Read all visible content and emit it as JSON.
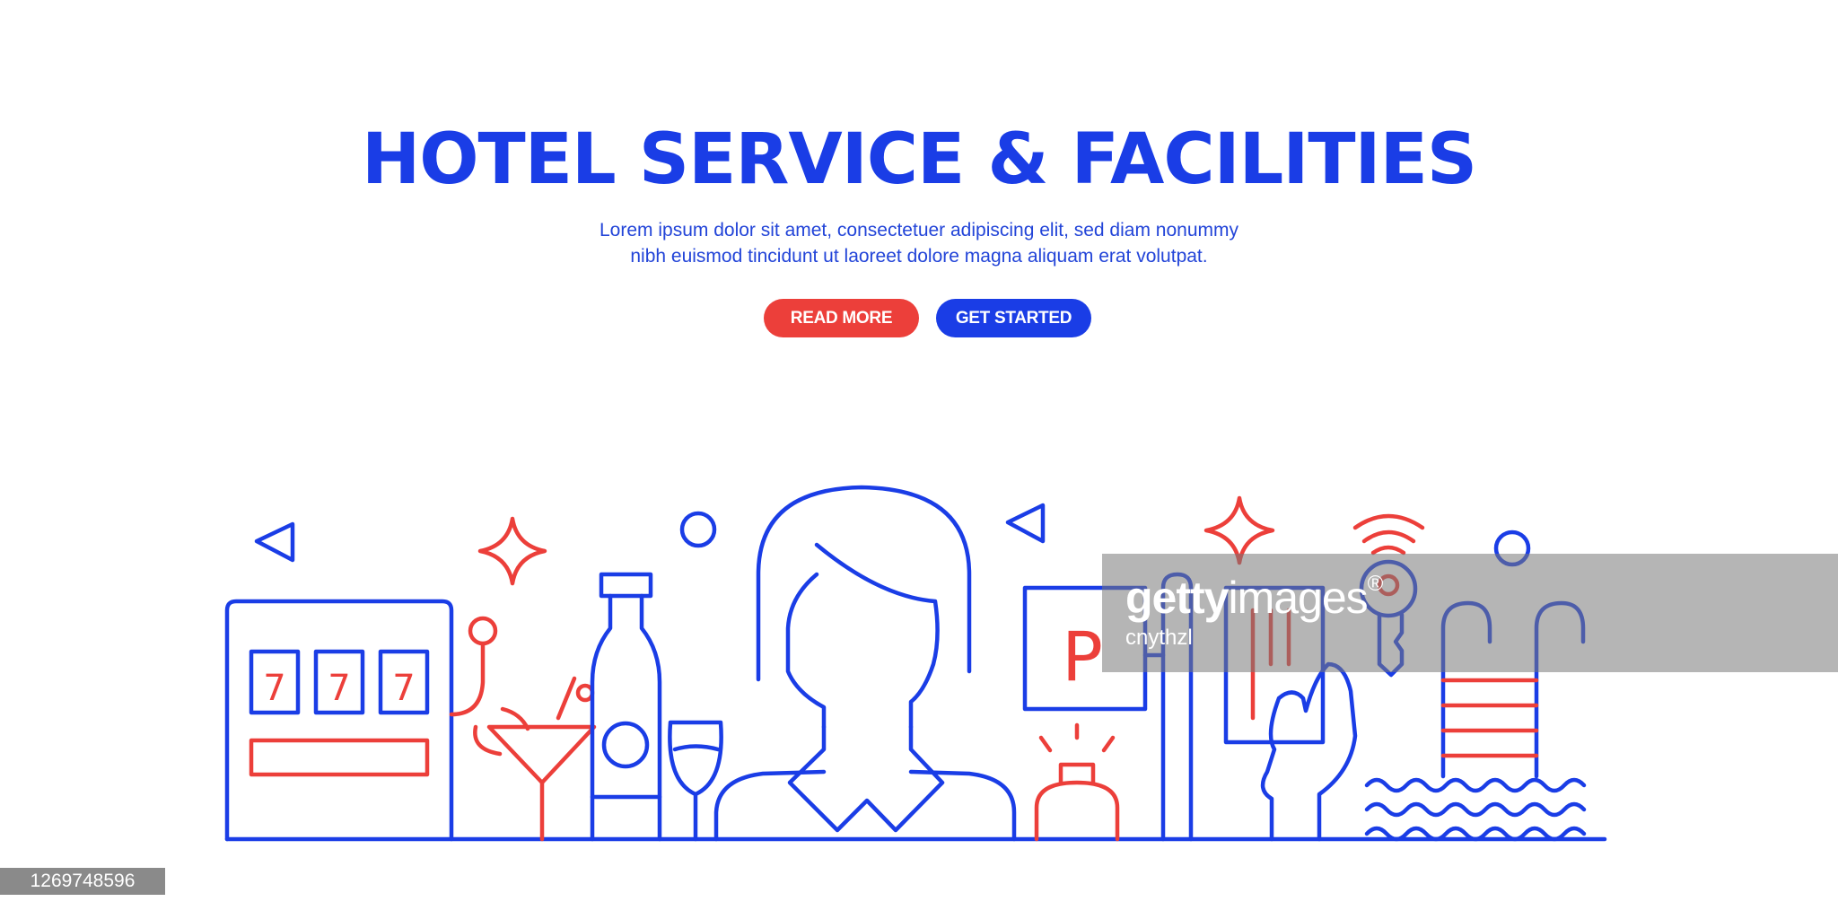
{
  "hero": {
    "title": "HOTEL SERVICE & FACILITIES",
    "subtitle_line1": "Lorem ipsum dolor sit amet, consectetuer adipiscing elit, sed diam nonummy",
    "subtitle_line2": "nibh euismod tincidunt ut laoreet dolore magna aliquam erat volutpat.",
    "read_more_label": "READ MORE",
    "get_started_label": "GET STARTED"
  },
  "illustration": {
    "slot_digits": [
      "7",
      "7",
      "7"
    ],
    "parking_sign": "P",
    "icons": [
      "slot-machine-icon",
      "cocktail-icon",
      "wine-bottle-icon",
      "wine-glass-icon",
      "receptionist-icon",
      "parking-sign-icon",
      "service-bell-icon",
      "key-card-icon",
      "smart-key-icon",
      "pool-ladder-icon",
      "water-waves-icon"
    ]
  },
  "watermark": {
    "brand_bold": "getty",
    "brand_regular": "images",
    "registered": "®",
    "author": "cnythzl"
  },
  "image_id": "1269748596",
  "colors": {
    "blue": "#1a3de6",
    "red": "#ec3f3a",
    "background": "#ffffff"
  }
}
